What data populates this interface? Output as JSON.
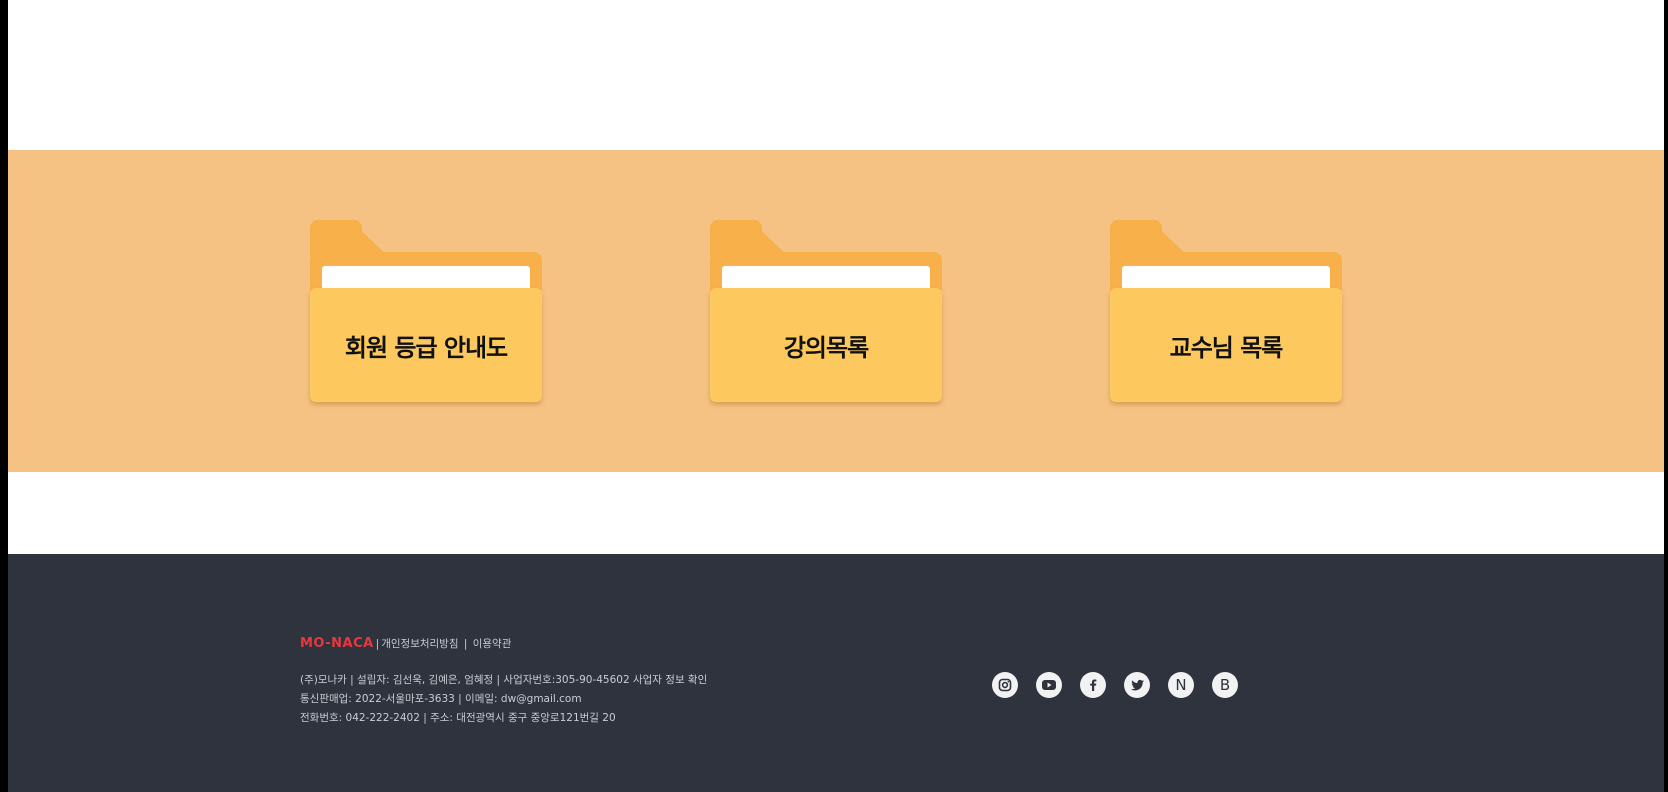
{
  "folders": [
    {
      "label": "회원 등급 안내도"
    },
    {
      "label": "강의목록"
    },
    {
      "label": "교수님 목록"
    }
  ],
  "footer": {
    "brand": "MO-NACA",
    "privacy_link": "개인정보처리방침",
    "terms_link": "이용약관",
    "info_lines": [
      "(주)모나카 | 설립자: 김선욱, 김예은, 엄혜정 | 사업자번호:305-90-45602 사업자 정보 확인",
      "통신판매업: 2022-서울마포-3633 | 이메일: dw@gmail.com",
      "전화번호: 042-222-2402 | 주소: 대전광역시 중구 중앙로121번길 20"
    ],
    "social": [
      {
        "icon": "instagram-icon"
      },
      {
        "icon": "youtube-icon"
      },
      {
        "icon": "facebook-icon"
      },
      {
        "icon": "twitter-icon"
      },
      {
        "icon": "naver-icon",
        "text": "N"
      },
      {
        "icon": "blog-icon",
        "text": "B"
      }
    ]
  },
  "colors": {
    "band": "#f5c283",
    "folder_back": "#f8b04a",
    "folder_front": "#fdc95e",
    "footer_bg": "#2e333d",
    "brand": "#e8383e"
  }
}
